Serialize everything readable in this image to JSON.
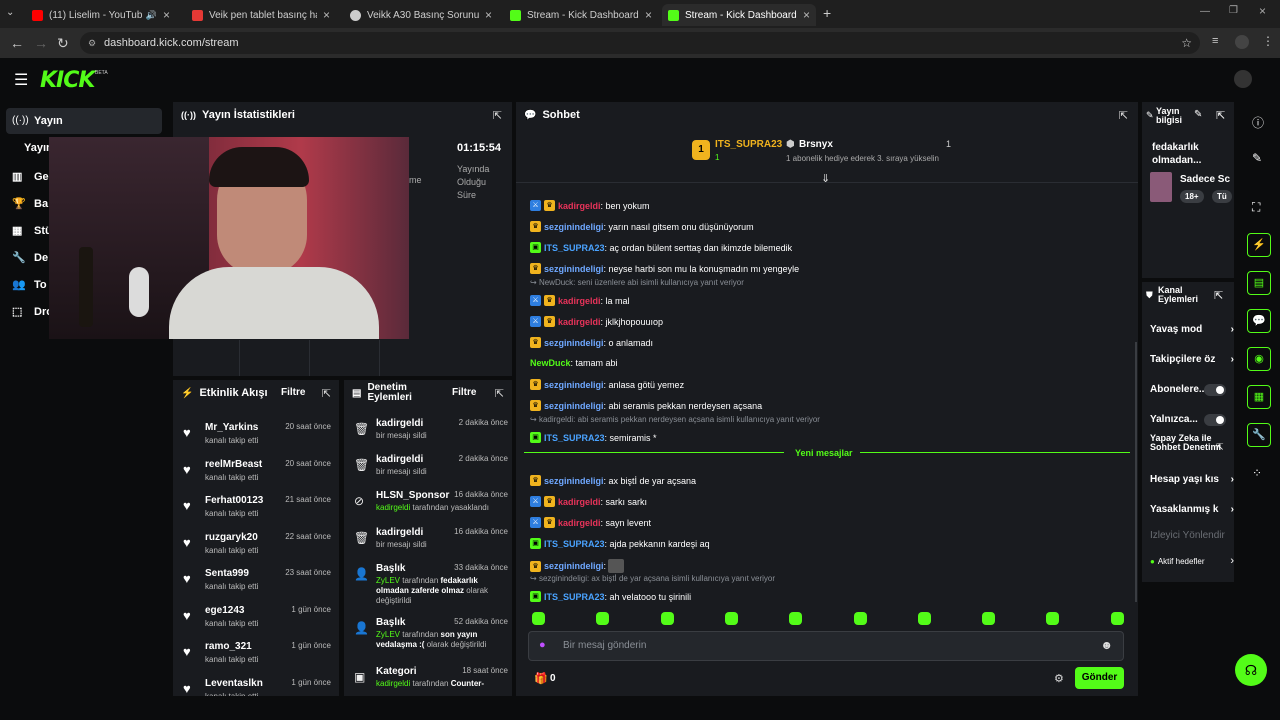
{
  "browser": {
    "tabs": [
      {
        "title": "(11) Liselim - YouTube",
        "color": "#ff0000"
      },
      {
        "title": "Veik pen tablet basınç hassasiyeti",
        "color": "#e53935"
      },
      {
        "title": "Veikk A30 Basınç Sorunu",
        "color": "#cccccc"
      },
      {
        "title": "Stream - Kick Dashboard",
        "color": "#53fc18"
      },
      {
        "title": "Stream - Kick Dashboard",
        "color": "#53fc18"
      }
    ],
    "url": "dashboard.kick.com/stream"
  },
  "app": {
    "logo": "KICK",
    "beta": "BETA"
  },
  "sidebar": {
    "active": "Yayın",
    "items": [
      "Yayın",
      "Ge",
      "Ba",
      "Stü",
      "De",
      "To",
      "Dro"
    ]
  },
  "stats": {
    "title": "Yayın İstatistikleri",
    "time": "01:15:54",
    "time_label": "Yayında Olduğu Süre",
    "partial": "me"
  },
  "activity": {
    "title": "Etkinlik Akışı",
    "filter": "Filtre",
    "items": [
      {
        "name": "Mr_Yarkins",
        "sub": "kanalı takip etti",
        "time": "20 saat önce"
      },
      {
        "name": "reelMrBeast",
        "sub": "kanalı takip etti",
        "time": "20 saat önce"
      },
      {
        "name": "Ferhat00123",
        "sub": "kanalı takip etti",
        "time": "21 saat önce"
      },
      {
        "name": "ruzgaryk20",
        "sub": "kanalı takip etti",
        "time": "22 saat önce"
      },
      {
        "name": "Senta999",
        "sub": "kanalı takip etti",
        "time": "23 saat önce"
      },
      {
        "name": "ege1243",
        "sub": "kanalı takip etti",
        "time": "1 gün önce"
      },
      {
        "name": "ramo_321",
        "sub": "kanalı takip etti",
        "time": "1 gün önce"
      },
      {
        "name": "Leventaslkn",
        "sub": "kanalı takip etti",
        "time": "1 gün önce"
      }
    ]
  },
  "mod": {
    "title": "Denetim Eylemleri",
    "filter": "Filtre",
    "items": [
      {
        "icon": "trash-icon",
        "name": "kadirgeldi",
        "time": "2 dakika önce",
        "pre": "",
        "actor": "",
        "mid": "bir mesajı sildi",
        "bold": "",
        "post": ""
      },
      {
        "icon": "trash-icon",
        "name": "kadirgeldi",
        "time": "2 dakika önce",
        "pre": "",
        "actor": "",
        "mid": "bir mesajı sildi",
        "bold": "",
        "post": ""
      },
      {
        "icon": "ban-icon",
        "name": "HLSN_Sponsor",
        "time": "16 dakika önce",
        "pre": "",
        "actor": "kadirgeldi",
        "mid": " tarafından yasaklandı",
        "bold": "",
        "post": ""
      },
      {
        "icon": "trash-icon",
        "name": "kadirgeldi",
        "time": "16 dakika önce",
        "pre": "",
        "actor": "",
        "mid": "bir mesajı sildi",
        "bold": "",
        "post": ""
      },
      {
        "icon": "user-edit-icon",
        "name": "Başlık",
        "time": "33 dakika önce",
        "pre": "",
        "actor": "ZyLEV",
        "mid": " tarafından ",
        "bold": "fedakarlık olmadan zaferde olmaz",
        "post": " olarak değiştirildi"
      },
      {
        "icon": "user-edit-icon",
        "name": "Başlık",
        "time": "52 dakika önce",
        "pre": "",
        "actor": "ZyLEV",
        "mid": " tarafından ",
        "bold": "son yayın vedalaşma :(",
        "post": " olarak değiştirildi"
      },
      {
        "icon": "category-icon",
        "name": "Kategori",
        "time": "18 saat önce",
        "pre": "",
        "actor": "kadirgeldi",
        "mid": " tarafından ",
        "bold": "Counter-",
        "post": ""
      }
    ]
  },
  "chat": {
    "title": "Sohbet",
    "top_user": "ITS_SUPRA23",
    "top_count": "1",
    "gift_user": "Brsnyx",
    "gift_count": "1",
    "gift_text": "1 abonelik hediye ederek 3. sıraya yükselin",
    "new_messages": "Yeni mesajlar",
    "messages": [
      {
        "user": "kadirgeldi",
        "ucolor": "#e8335a",
        "badges": [
          "b-blue",
          "b-gold"
        ],
        "text": ": ben yokum"
      },
      {
        "user": "sezginindeligi",
        "ucolor": "#6fa8ff",
        "badges": [
          "b-gold"
        ],
        "text": ": yarın nasıl gitsem onu düşünüyorum"
      },
      {
        "user": "ITS_SUPRA23",
        "ucolor": "#4aa3ff",
        "badges": [
          "b-green"
        ],
        "text": ": aç ordan bülent serttaş dan ikimzde bilemedik"
      },
      {
        "user": "sezginindeligi",
        "ucolor": "#6fa8ff",
        "badges": [
          "b-gold"
        ],
        "text": ": neyse harbi son mu la konuşmadın mı yengeyle"
      },
      {
        "user": "kadirgeldi",
        "ucolor": "#e8335a",
        "badges": [
          "b-blue",
          "b-gold"
        ],
        "text": ": la mal"
      },
      {
        "user": "kadirgeldi",
        "ucolor": "#e8335a",
        "badges": [
          "b-blue",
          "b-gold"
        ],
        "text": ": jklkjhopouuıop"
      },
      {
        "user": "sezginindeligi",
        "ucolor": "#6fa8ff",
        "badges": [
          "b-gold"
        ],
        "text": ": o anlamadı"
      },
      {
        "user": "NewDuck",
        "ucolor": "#53fc18",
        "badges": [],
        "text": ": tamam abi"
      },
      {
        "user": "sezginindeligi",
        "ucolor": "#6fa8ff",
        "badges": [
          "b-gold"
        ],
        "text": ": anlasa götü yemez"
      },
      {
        "user": "sezginindeligi",
        "ucolor": "#6fa8ff",
        "badges": [
          "b-gold"
        ],
        "text": ": abi seramis pekkan nerdeysen açsana"
      },
      {
        "user": "ITS_SUPRA23",
        "ucolor": "#4aa3ff",
        "badges": [
          "b-green"
        ],
        "text": ": semiramis *"
      },
      {
        "user": "sezginindeligi",
        "ucolor": "#6fa8ff",
        "badges": [
          "b-gold"
        ],
        "text": ": ax biştİ de yar açsana"
      },
      {
        "user": "kadirgeldi",
        "ucolor": "#e8335a",
        "badges": [
          "b-blue",
          "b-gold"
        ],
        "text": ": sarkı sarkı"
      },
      {
        "user": "kadirgeldi",
        "ucolor": "#e8335a",
        "badges": [
          "b-blue",
          "b-gold"
        ],
        "text": ": sayn levent"
      },
      {
        "user": "ITS_SUPRA23",
        "ucolor": "#4aa3ff",
        "badges": [
          "b-green"
        ],
        "text": ": ajda pekkanın kardeşi aq"
      },
      {
        "user": "sezginindeligi",
        "ucolor": "#6fa8ff",
        "badges": [
          "b-gold"
        ],
        "text": ": "
      },
      {
        "user": "ITS_SUPRA23",
        "ucolor": "#4aa3ff",
        "badges": [
          "b-green"
        ],
        "text": ": ah velatooo tu şirinili"
      }
    ],
    "replies": [
      "NewDuck: seni üzenlere abi isimli kullanıcıya yanıt veriyor",
      "kadirgeldi: abi seramis pekkan nerdeysen açsana isimli kullanıcıya yanıt veriyor",
      "sezginindeligi: ax biştİ de yar açsana isimli kullanıcıya yanıt veriyor"
    ],
    "placeholder": "Bir mesaj gönderin",
    "points": "0",
    "send": "Gönder"
  },
  "info": {
    "title": "Yayın bilgisi",
    "stream_title": "fedakarlık olmadan...",
    "category": "Sadece Sc",
    "tag1": "18+",
    "tag2": "Tü"
  },
  "channel": {
    "title": "Kanal Eylemleri",
    "items": [
      "Yavaş mod",
      "Takipçilere öz",
      "Abonelere...",
      "Yalnızca...",
      "Yapay Zeka ile Sohbet Denetimi",
      "Hesap yaşı kıs",
      "Yasaklanmış k",
      "İzleyici Yönlendir",
      "Aktif hedefler"
    ]
  }
}
